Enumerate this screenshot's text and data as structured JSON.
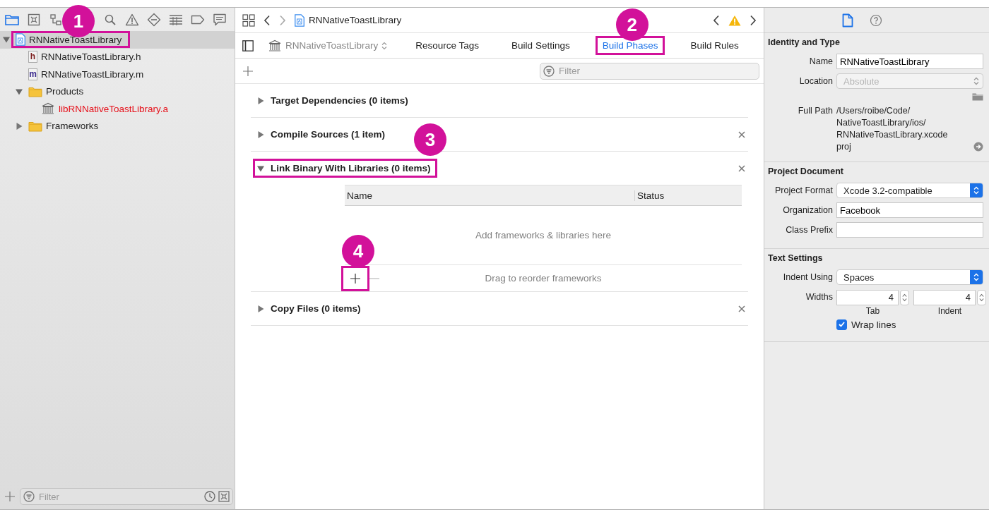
{
  "navigator": {
    "tabs": [
      {
        "kind": "folder",
        "selected": true
      },
      {
        "kind": "boxed-x",
        "selected": false
      },
      {
        "kind": "hierarchy",
        "selected": false
      },
      {
        "kind": "search",
        "selected": false
      },
      {
        "kind": "warning",
        "selected": false
      },
      {
        "kind": "diamond",
        "selected": false
      },
      {
        "kind": "list",
        "selected": false
      },
      {
        "kind": "tag",
        "selected": false
      },
      {
        "kind": "speech-bubble",
        "selected": false
      }
    ],
    "tree": [
      {
        "kind": "project",
        "label": "RNNativeToastLibrary",
        "expanded": true,
        "selected": true,
        "missing": false,
        "callout": "1",
        "children": [
          {
            "kind": "header",
            "icon_letter": "h",
            "label": "RNNativeToastLibrary.h",
            "selected": false,
            "missing": false
          },
          {
            "kind": "source",
            "icon_letter": "m",
            "label": "RNNativeToastLibrary.m",
            "selected": false,
            "missing": false
          },
          {
            "kind": "folder",
            "label": "Products",
            "expanded": true,
            "selected": false,
            "missing": false,
            "children": [
              {
                "kind": "library",
                "label": "libRNNativeToastLibrary.a",
                "selected": false,
                "missing": true
              }
            ]
          },
          {
            "kind": "folder",
            "label": "Frameworks",
            "expanded": false,
            "selected": false,
            "missing": false
          }
        ]
      }
    ],
    "filter": {
      "placeholder": "Filter"
    }
  },
  "editor": {
    "jump_bar": {
      "title": "RNNativeToastLibrary"
    },
    "target": "RNNativeToastLibrary",
    "tabs": [
      {
        "label": "Resource Tags",
        "selected": false
      },
      {
        "label": "Build Settings",
        "selected": false
      },
      {
        "label": "Build Phases",
        "selected": true,
        "callout": "2"
      },
      {
        "label": "Build Rules",
        "selected": false
      }
    ],
    "filter": {
      "placeholder": "Filter"
    },
    "phases": [
      {
        "title": "Target Dependencies (0 items)",
        "expanded": false,
        "removable": false
      },
      {
        "title": "Compile Sources (1 item)",
        "expanded": false,
        "removable": true
      },
      {
        "title": "Link Binary With Libraries (0 items)",
        "expanded": true,
        "removable": true,
        "callout": "3",
        "table": {
          "columns": [
            "Name",
            "Status"
          ],
          "empty_text": "Add frameworks & libraries here",
          "footer_hint": "Drag to reorder frameworks",
          "add_button": {
            "callout": "4"
          }
        }
      },
      {
        "title": "Copy Files (0 items)",
        "expanded": false,
        "removable": true
      }
    ]
  },
  "inspector": {
    "tabs": [
      {
        "kind": "file",
        "selected": true
      },
      {
        "kind": "help",
        "selected": false
      }
    ],
    "sections": [
      {
        "title": "Identity and Type",
        "rows": [
          {
            "kind": "text",
            "label": "Name",
            "value": "RNNativeToastLibrary"
          },
          {
            "kind": "popup",
            "label": "Location",
            "value": "Absolute",
            "disabled": true
          },
          {
            "kind": "path",
            "label": "Full Path",
            "lines": [
              "/Users/roibe/Code/",
              "NativeToastLibrary/ios/",
              "RNNativeToastLibrary.xcode",
              "proj"
            ]
          }
        ]
      },
      {
        "title": "Project Document",
        "rows": [
          {
            "kind": "popup",
            "label": "Project Format",
            "value": "Xcode 3.2-compatible",
            "disabled": false
          },
          {
            "kind": "text",
            "label": "Organization",
            "value": "Facebook"
          },
          {
            "kind": "text",
            "label": "Class Prefix"
          }
        ]
      },
      {
        "title": "Text Settings",
        "rows": [
          {
            "kind": "popup",
            "label": "Indent Using",
            "value": "Spaces",
            "disabled": false
          },
          {
            "kind": "steppers",
            "label": "Widths",
            "fields": [
              {
                "value": "4",
                "caption": "Tab"
              },
              {
                "value": "4",
                "caption": "Indent"
              }
            ]
          },
          {
            "kind": "checkbox",
            "label": "Wrap lines",
            "checked": true
          }
        ]
      }
    ]
  }
}
